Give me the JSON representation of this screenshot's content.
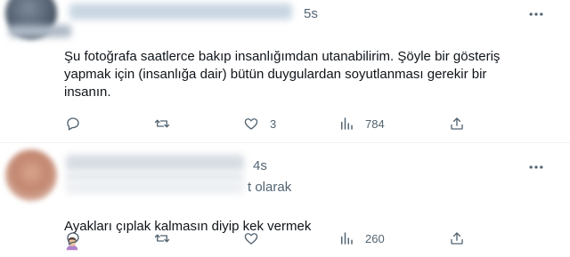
{
  "tweets": [
    {
      "time": "5s",
      "text": "Şu fotoğrafa saatlerce bakıp insanlığımdan utanabilirim. Şöyle bir gösteriş\nyapmak için (insanlığa dair) bütün duygulardan soyutlanması gerekir bir\ninsanın.",
      "actions": {
        "reply": "",
        "retweet": "",
        "like": "3",
        "views": "784"
      }
    },
    {
      "time": "4s",
      "reply_context": "t olarak",
      "text": "Ayakları çıplak kalmasın diyip kek vermek",
      "actions": {
        "reply": "",
        "retweet": "",
        "like": "",
        "views": "260"
      }
    }
  ],
  "colors": {
    "text": "#0f1419",
    "secondary": "#536471",
    "divider": "#eff3f4"
  }
}
